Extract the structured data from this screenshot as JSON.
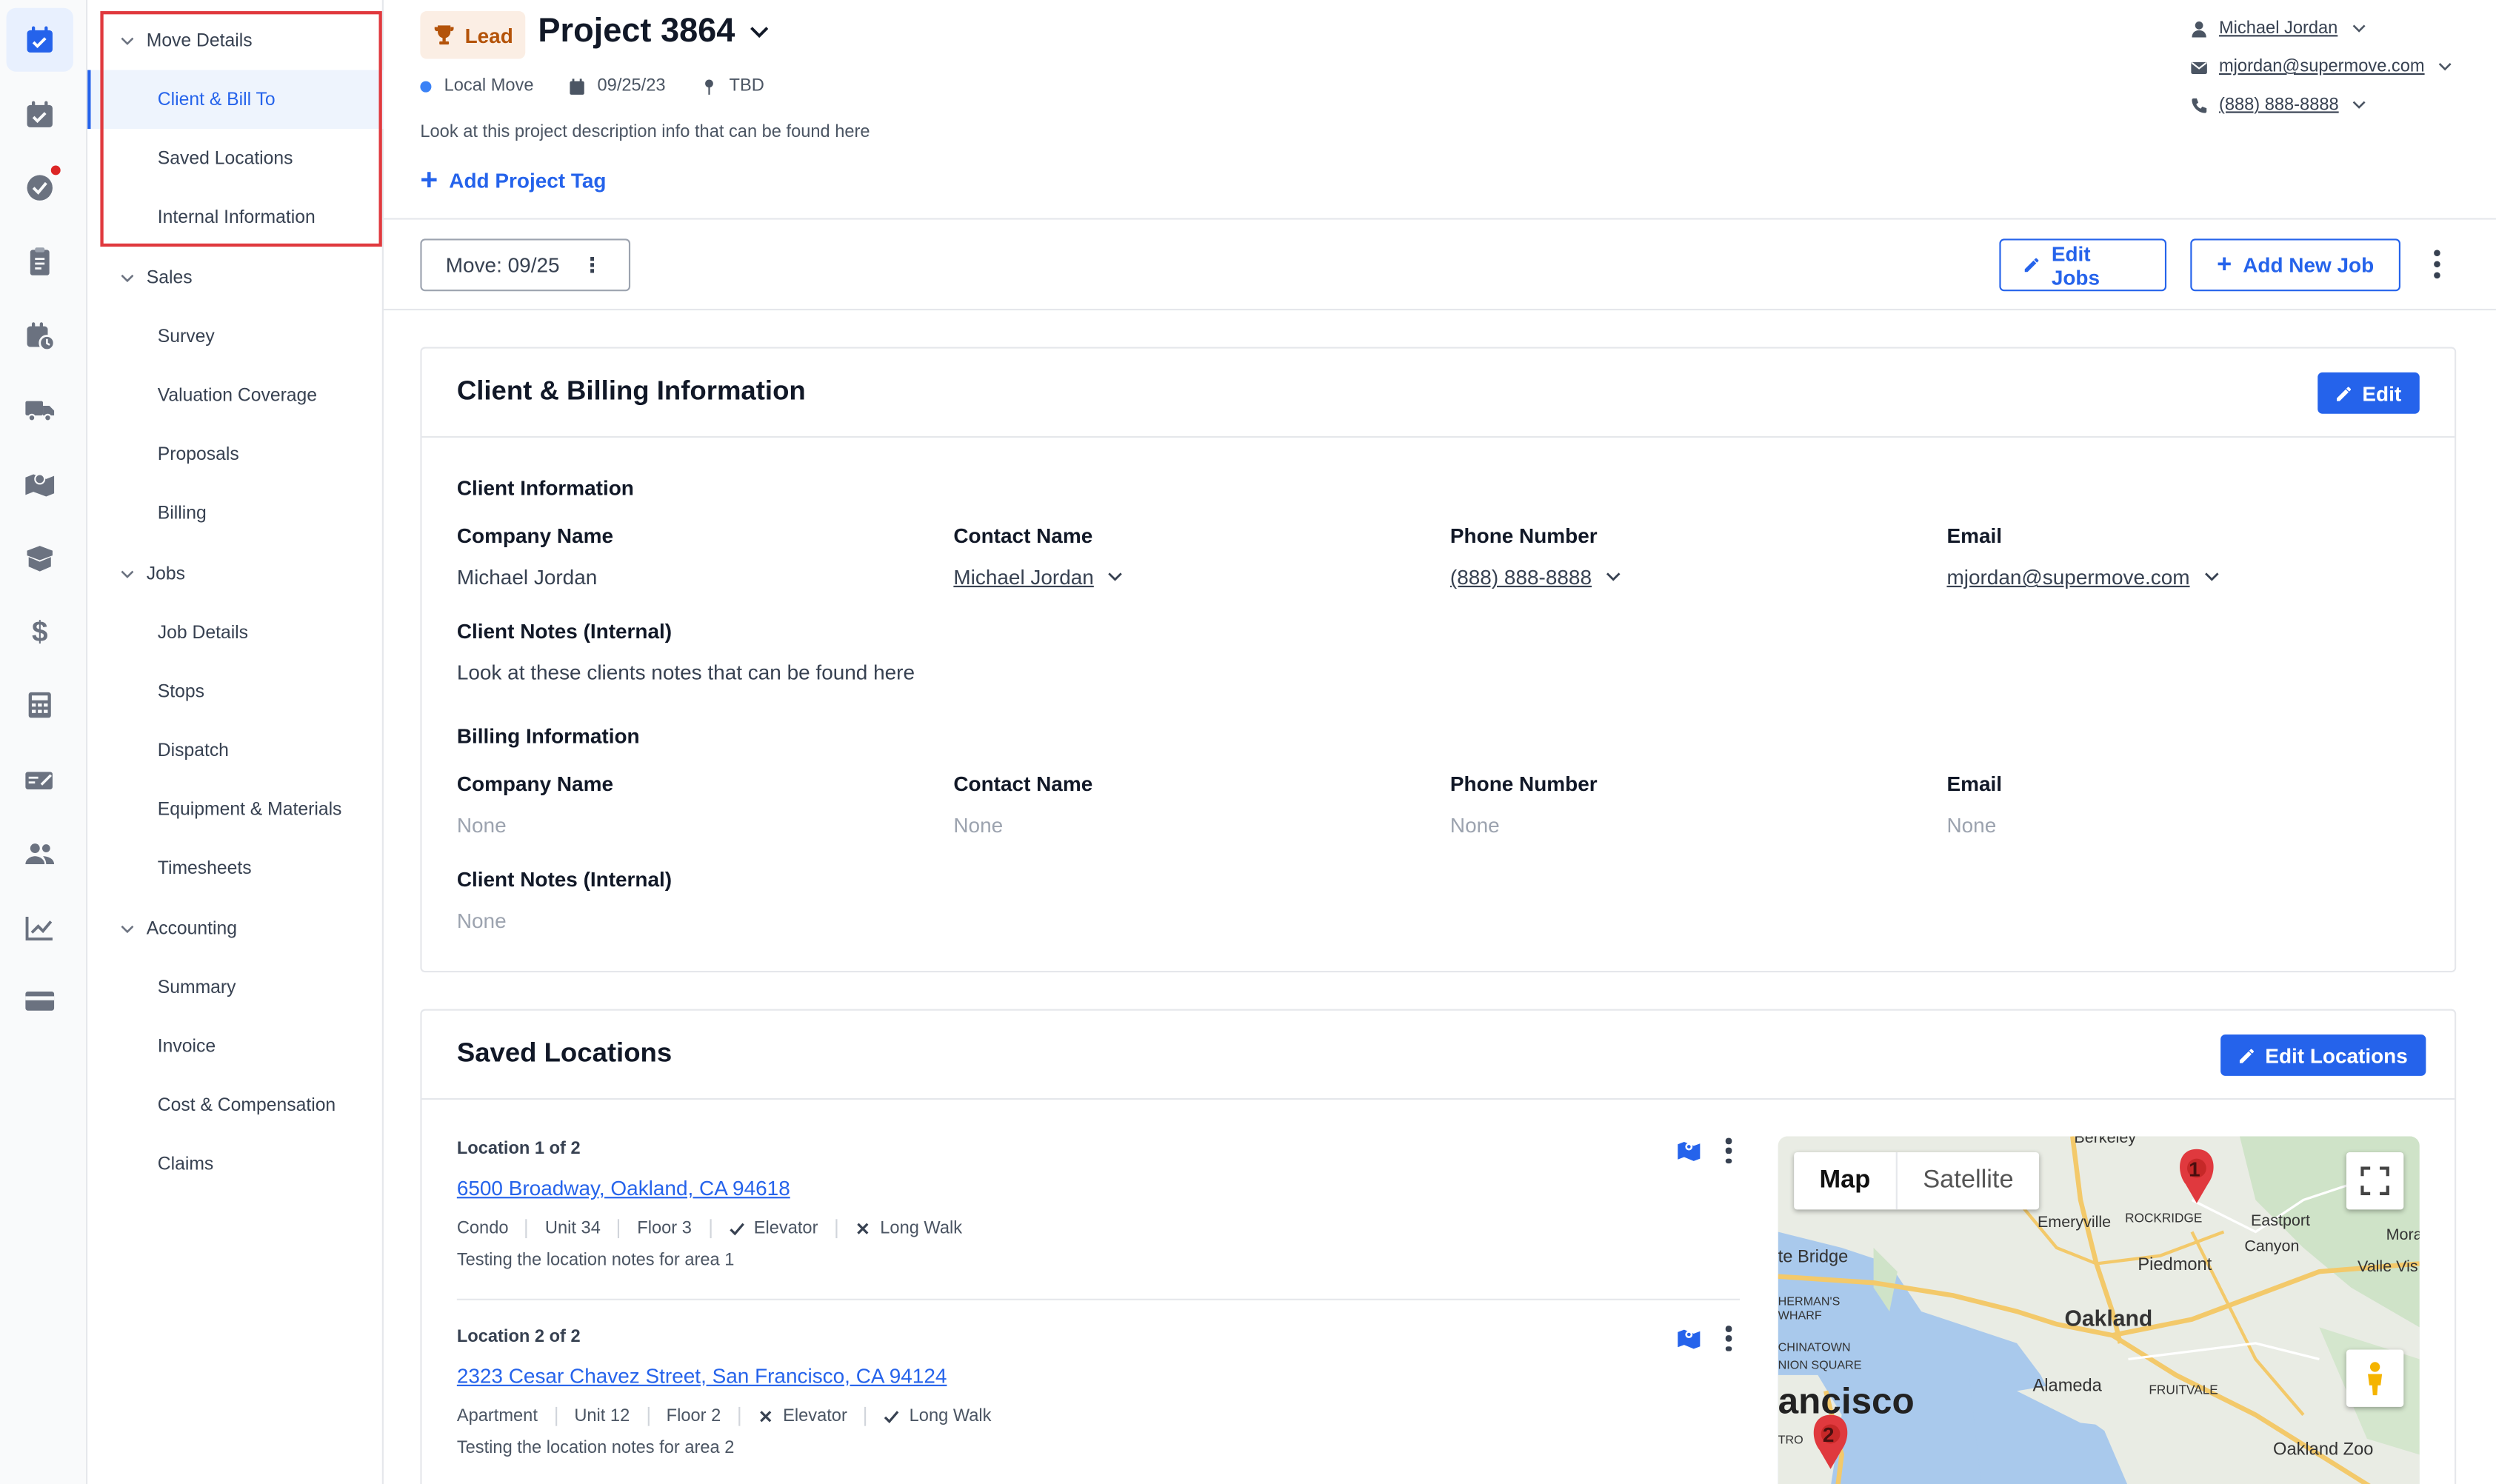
{
  "rail": {
    "icons": [
      "calendar-check-icon",
      "calendar-icon",
      "check-circle-icon",
      "clipboard-icon",
      "calendar-clock-icon",
      "truck-icon",
      "map-icon",
      "box-icon",
      "dollar-icon",
      "calculator-icon",
      "invoice-icon",
      "users-icon",
      "chart-icon",
      "card-icon"
    ]
  },
  "nav": {
    "groups": [
      {
        "label": "Move Details",
        "items": [
          "Client & Bill To",
          "Saved Locations",
          "Internal Information"
        ]
      },
      {
        "label": "Sales",
        "items": [
          "Survey",
          "Valuation Coverage",
          "Proposals",
          "Billing"
        ]
      },
      {
        "label": "Jobs",
        "items": [
          "Job Details",
          "Stops",
          "Dispatch",
          "Equipment & Materials",
          "Timesheets"
        ]
      },
      {
        "label": "Accounting",
        "items": [
          "Summary",
          "Invoice",
          "Cost & Compensation",
          "Claims"
        ]
      }
    ],
    "active_item": "Client & Bill To"
  },
  "header": {
    "badge": "Lead",
    "title": "Project 3864",
    "move_type": "Local Move",
    "date": "09/25/23",
    "location": "TBD",
    "description": "Look at this project description info that can be found here",
    "add_tag": "Add Project Tag",
    "contact_name": "Michael Jordan",
    "contact_email": "mjordan@supermove.com",
    "contact_phone": "(888) 888-8888"
  },
  "toolbar": {
    "move_pill": "Move: 09/25",
    "edit_jobs": "Edit Jobs",
    "add_new_job": "Add New Job"
  },
  "client_card": {
    "title": "Client & Billing Information",
    "edit": "Edit",
    "client_section": "Client Information",
    "billing_section": "Billing Information",
    "labels": {
      "company": "Company Name",
      "contact": "Contact Name",
      "phone": "Phone Number",
      "email": "Email",
      "notes": "Client Notes (Internal)"
    },
    "client": {
      "company": "Michael Jordan",
      "contact": "Michael Jordan",
      "phone": "(888) 888-8888",
      "email": "mjordan@supermove.com",
      "notes": "Look at these clients notes that can be found here"
    },
    "billing": {
      "company": "None",
      "contact": "None",
      "phone": "None",
      "email": "None",
      "notes": "None"
    }
  },
  "locations_card": {
    "title": "Saved Locations",
    "edit": "Edit Locations",
    "locations": [
      {
        "label": "Location 1 of 2",
        "address": "6500 Broadway, Oakland, CA 94618",
        "type": "Condo",
        "unit": "Unit 34",
        "floor": "Floor 3",
        "elevator": "Elevator",
        "long_walk": "Long Walk",
        "note": "Testing the location notes for area 1"
      },
      {
        "label": "Location 2 of 2",
        "address": "2323 Cesar Chavez Street, San Francisco, CA 94124",
        "type": "Apartment",
        "unit": "Unit 12",
        "floor": "Floor 2",
        "elevator": "Elevator",
        "long_walk": "Long Walk",
        "note": "Testing the location notes for area 2"
      }
    ]
  },
  "map": {
    "tab_map": "Map",
    "tab_satellite": "Satellite",
    "labels": {
      "berkeley": "Berkeley",
      "emeryville": "Emeryville",
      "rockridge": "ROCKRIDGE",
      "eastport": "Eastport",
      "canyon": "Canyon",
      "moraga": "Mora",
      "valle": "Valle Vis",
      "bridge": "te Bridge",
      "piedmont": "Piedmont",
      "herman": "HERMAN'S",
      "wharf": "WHARF",
      "oakland": "Oakland",
      "chinatown": "CHINATOWN",
      "union": "NION SQUARE",
      "sf": "ancisco",
      "alameda": "Alameda",
      "fruitvale": "FRUITVALE",
      "zoo": "Oakland Zoo",
      "tro": "TRO"
    },
    "pin1": "1",
    "pin2": "2"
  }
}
